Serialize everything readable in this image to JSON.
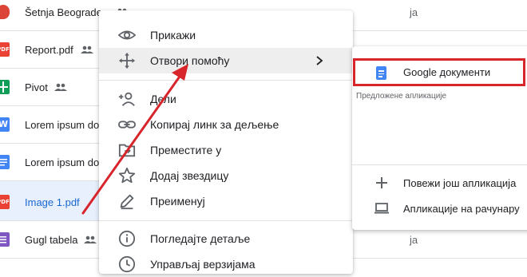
{
  "files": [
    {
      "name": "Šetnja Beograde",
      "type": "map",
      "icon_color": "#db4437",
      "owner": "ja",
      "shared": true
    },
    {
      "name": "Report.pdf",
      "type": "pdf",
      "icon_label": "PDF",
      "icon_color": "#ea4335",
      "shared": true
    },
    {
      "name": "Pivot",
      "type": "sheet",
      "icon_color": "#0f9d58",
      "shared": true
    },
    {
      "name": "Lorem ipsum do",
      "type": "word",
      "icon_label": "W",
      "icon_color": "#4285f4"
    },
    {
      "name": "Lorem ipsum do",
      "type": "doc",
      "icon_color": "#4285f4"
    },
    {
      "name": "Image 1.pdf",
      "type": "pdf",
      "icon_label": "PDF",
      "icon_color": "#ea4335",
      "selected": true
    },
    {
      "name": "Gugl tabela",
      "type": "form",
      "icon_color": "#7e57c2",
      "owner": "ja",
      "shared": true
    }
  ],
  "context_menu": {
    "items": [
      {
        "label": "Прикажи",
        "icon": "eye-icon"
      },
      {
        "label": "Отвори помоћу",
        "icon": "move-icon",
        "has_submenu": true,
        "highlighted": true
      },
      {
        "label": "Дели",
        "icon": "add-person-icon"
      },
      {
        "label": "Копирај линк за дељење",
        "icon": "link-icon"
      },
      {
        "label": "Преместите у",
        "icon": "folder-move-icon"
      },
      {
        "label": "Додај звездицу",
        "icon": "star-icon"
      },
      {
        "label": "Преименуј",
        "icon": "pencil-icon"
      },
      {
        "label": "Погледајте детаље",
        "icon": "info-icon"
      },
      {
        "label": "Управљај верзијама",
        "icon": "history-icon"
      }
    ]
  },
  "submenu": {
    "primary": {
      "label": "Google документи",
      "icon": "google-docs-icon"
    },
    "suggested_label": "Предложене апликације",
    "connect": {
      "label": "Повежи још апликација",
      "icon": "plus-icon"
    },
    "computer": {
      "label": "Апликације на рачунару",
      "icon": "laptop-icon"
    }
  },
  "colors": {
    "annotation": "#d7252b",
    "selected_row": "#e8f0fe",
    "accent": "#1967d2"
  }
}
